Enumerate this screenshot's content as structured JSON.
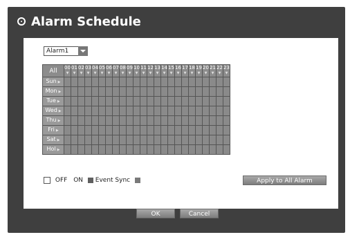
{
  "dialog": {
    "title": "Alarm Schedule",
    "alarm_select": "Alarm1",
    "all_label": "All",
    "hours": [
      "00",
      "01",
      "02",
      "03",
      "04",
      "05",
      "06",
      "07",
      "08",
      "09",
      "10",
      "11",
      "12",
      "13",
      "14",
      "15",
      "16",
      "17",
      "18",
      "19",
      "20",
      "21",
      "22",
      "23"
    ],
    "days": [
      "Sun",
      "Mon",
      "Tue",
      "Wed",
      "Thu",
      "Fri",
      "Sat",
      "Hol"
    ],
    "legend": {
      "off_label": "OFF",
      "on_label": "ON",
      "event_sync_label": "Event Sync"
    },
    "apply_button": "Apply to All Alarm",
    "ok_button": "OK",
    "cancel_button": "Cancel"
  },
  "colors": {
    "frame": "#3f3f3f",
    "cell_off": "#8a8a8a",
    "on_swatch": "#5f5f5f",
    "event_sync_swatch": "#7a7a7a"
  }
}
